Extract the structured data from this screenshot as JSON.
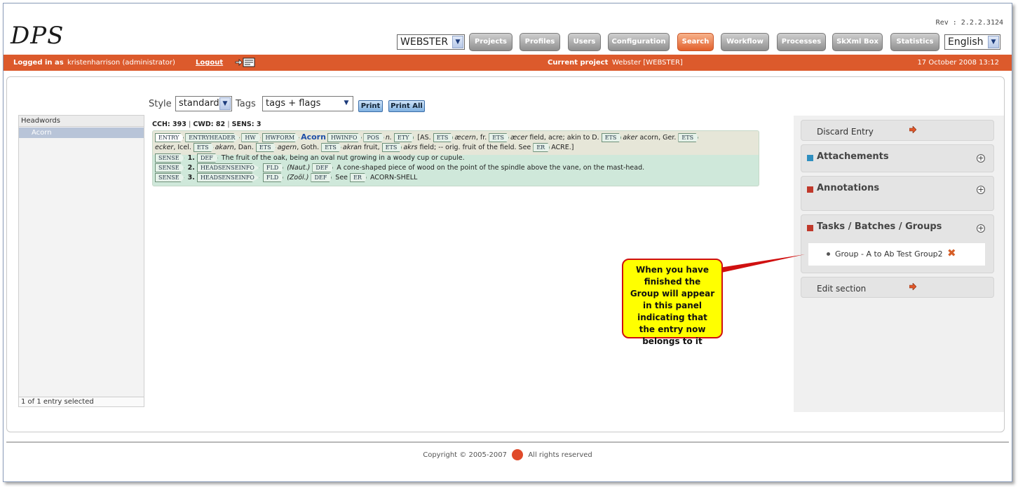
{
  "header": {
    "app_title": "DPS",
    "revision": "Rev : 2.2.2.3124",
    "project_select_value": "WEBSTER",
    "language_select_value": "English"
  },
  "nav": {
    "items": [
      {
        "label": "Projects"
      },
      {
        "label": "Profiles"
      },
      {
        "label": "Users"
      },
      {
        "label": "Configuration"
      },
      {
        "label": "Search"
      },
      {
        "label": "Workflow"
      },
      {
        "label": "Processes"
      },
      {
        "label": "SkXml Box"
      },
      {
        "label": "Statistics"
      }
    ],
    "active": "Search"
  },
  "status_bar": {
    "logged_in_label": "Logged in as",
    "user": "kristenharrison (administrator)",
    "logout": "Logout",
    "current_project_label": "Current project",
    "current_project_value": "Webster [WEBSTER]",
    "date": "17 October 2008 13:12"
  },
  "toolbar": {
    "style_label": "Style",
    "style_value": "standard",
    "tags_label": "Tags",
    "tags_value": "tags + flags",
    "print_label": "Print",
    "print_all_label": "Print All"
  },
  "headwords": {
    "header": "Headwords",
    "items": [
      "Acorn"
    ],
    "footer": "1 of 1 entry selected"
  },
  "entry": {
    "stats": {
      "cch": "CCH: 393",
      "cwd": "CWD: 82",
      "sens": "SENS: 3"
    },
    "headword": "Acorn",
    "pos": "n.",
    "tags": {
      "entry": "ENTRY",
      "entryheader": "ENTRYHEADER",
      "hw": "HW",
      "hwform": "HWFORM",
      "hwinfo": "HWINFO",
      "pos": "POS",
      "ety": "ETY",
      "ets": "ETS",
      "er": "ER",
      "sense": "SENSE",
      "def": "DEF",
      "headsenseinfo": "HEADSENSEINFO",
      "fld": "FLD"
    },
    "ety_text": {
      "p0": "[AS.",
      "w1": "æcern",
      "p1": ", fr.",
      "w2": "æcer",
      "p2": "field, acre; akin to D.",
      "w3": "aker",
      "p3": "acorn, Ger.",
      "w4": "ecker",
      "p4": ", Icel.",
      "w5": "akarn",
      "p5": ", Dan.",
      "w6": "agern",
      "p6": ", Goth.",
      "w7": "akran",
      "p7": "fruit,",
      "w8": "akrs",
      "p8": "field; -- orig. fruit of the field. See",
      "p9": "ACRE.]"
    },
    "senses": [
      {
        "num": "1.",
        "fld": "",
        "def": "The fruit of the oak, being an oval nut growing in a woody cup or cupule."
      },
      {
        "num": "2.",
        "fld": "(Naut.)",
        "def": "A cone-shaped piece of wood on the point of the spindle above the vane, on the mast-head."
      },
      {
        "num": "3.",
        "fld": "(Zoöl.)",
        "def": "See",
        "er": "ACORN-SHELL"
      }
    ]
  },
  "side": {
    "discard": "Discard Entry",
    "attachements": "Attachements",
    "annotations": "Annotations",
    "tasks": "Tasks / Batches / Groups",
    "group_item": "Group - A to Ab Test Group2",
    "edit_section": "Edit section",
    "colors": {
      "attach_square": "#2f8fc0",
      "annot_square": "#c0392b",
      "tasks_square": "#c0392b"
    }
  },
  "callout": {
    "text": "When you have finished the Group will appear in this panel indicating that the entry now belongs to it"
  },
  "footer": {
    "left": "Copyright © 2005-2007",
    "right": "All rights reserved"
  }
}
